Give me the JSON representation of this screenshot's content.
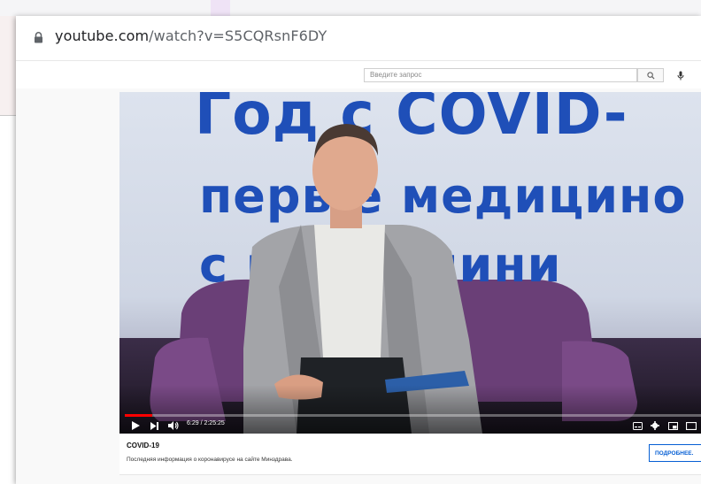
{
  "browser": {
    "url_domain": "youtube.com",
    "url_path": "/watch?v=S5CQRsnF6DY"
  },
  "youtube_header": {
    "search_placeholder": "Введите запрос",
    "search_icon": "search-icon",
    "mic_icon": "microphone-icon"
  },
  "video": {
    "slide_text": {
      "line1": "Год с COVID-",
      "line2": "перв   е медицино",
      "line3": "с р      ом клини"
    },
    "progress_fraction": 0.048,
    "time_current": "6:29",
    "time_separator": " / ",
    "time_total": "2:25:25",
    "colors": {
      "progress": "#ff0000",
      "slide_text": "#1f4fb8"
    }
  },
  "info_panel": {
    "title": "COVID-19",
    "text": "Последняя информация о коронавирусе на сайте Минздрава.",
    "button_label": "ПОДРОБНЕЕ."
  }
}
